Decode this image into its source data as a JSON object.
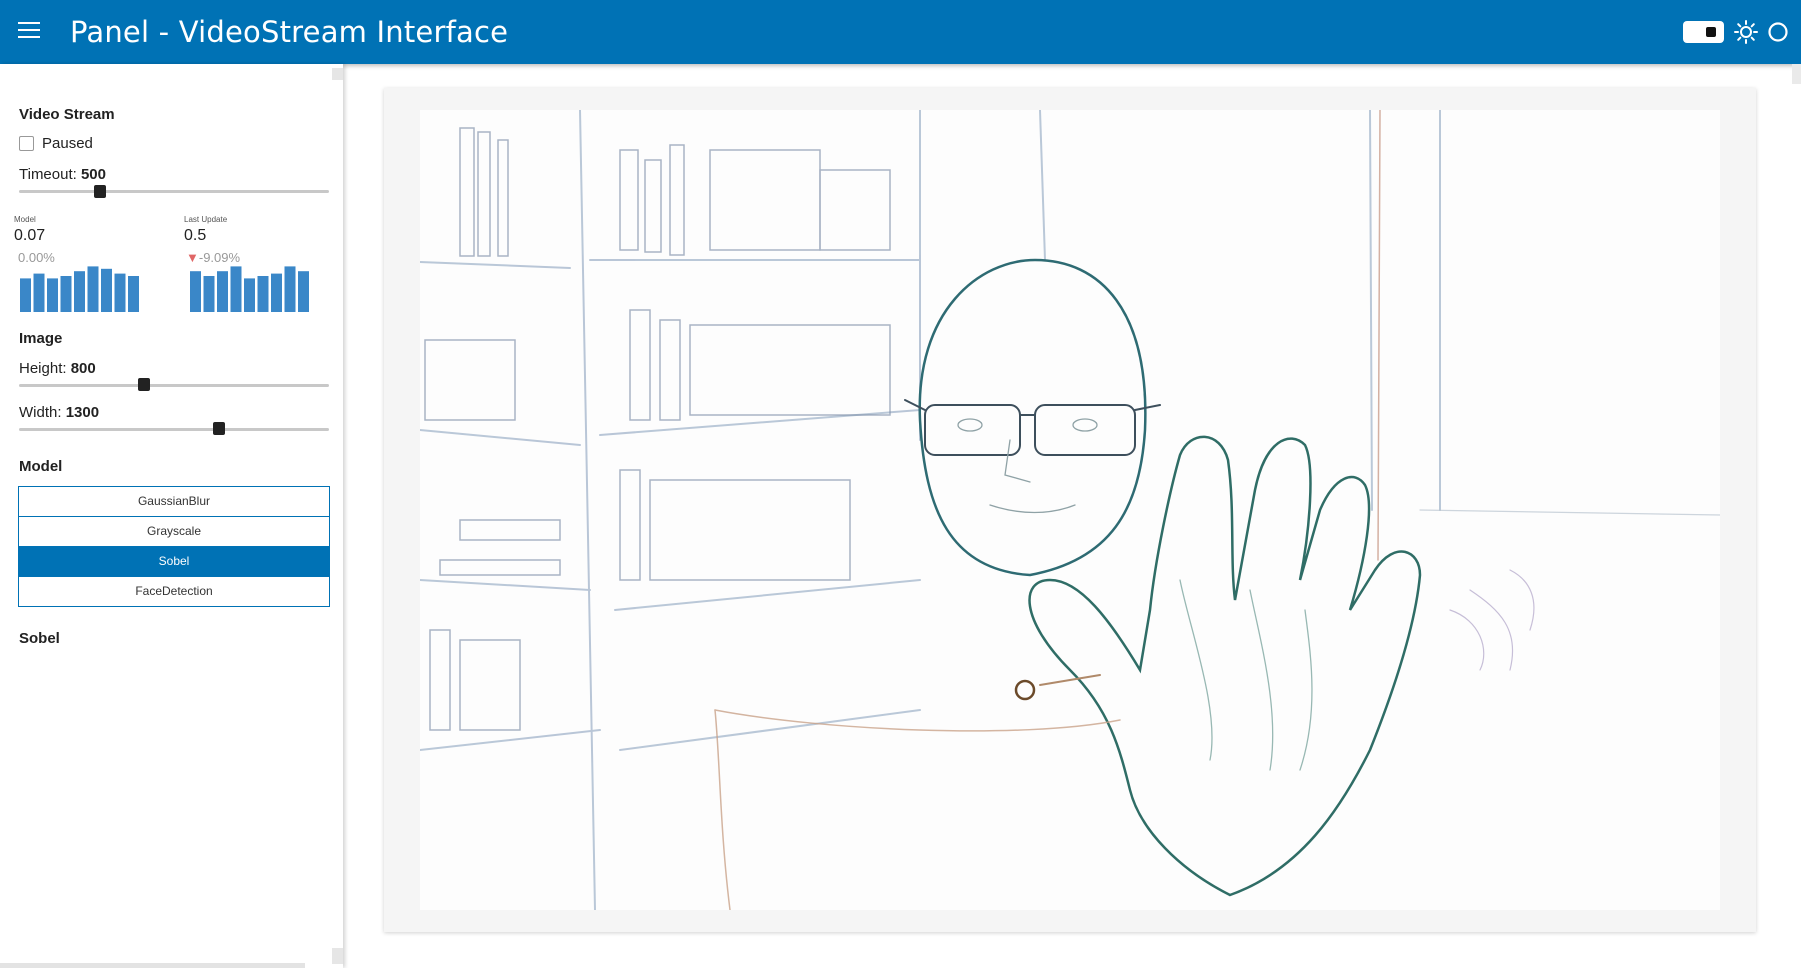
{
  "header": {
    "title": "Panel  -  VideoStream Interface",
    "color": "#0072b5"
  },
  "sidebar": {
    "video_stream": {
      "title": "Video Stream",
      "paused_label": "Paused",
      "paused": false,
      "timeout": {
        "label": "Timeout:",
        "value": "500",
        "level": 0.25
      }
    },
    "indicators": [
      {
        "title": "Model",
        "value": "0.07",
        "delta": "0.00%",
        "bars": [
          0.7,
          0.8,
          0.7,
          0.75,
          0.85,
          0.95,
          0.9,
          0.8,
          0.75
        ]
      },
      {
        "title": "Last Update",
        "value": "0.5",
        "delta": "-9.09%",
        "delta_color": "#e06666",
        "bars": [
          0.85,
          0.75,
          0.85,
          0.95,
          0.7,
          0.75,
          0.8,
          0.95,
          0.85
        ]
      }
    ],
    "image": {
      "title": "Image",
      "height": {
        "label": "Height:",
        "value": "800",
        "level": 0.4
      },
      "width": {
        "label": "Width:",
        "value": "1300",
        "level": 0.65
      }
    },
    "model": {
      "title": "Model",
      "options": [
        "GaussianBlur",
        "Grayscale",
        "Sobel",
        "FaceDetection"
      ],
      "selected": "Sobel"
    },
    "model_name": "Sobel"
  },
  "video": {
    "description_icon": "sobel-edge-frame"
  }
}
